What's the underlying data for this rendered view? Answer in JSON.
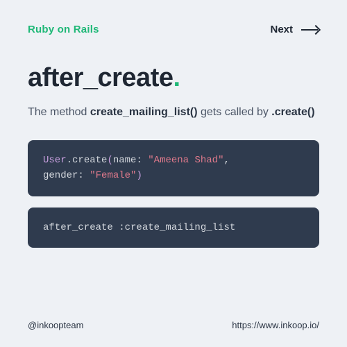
{
  "header": {
    "brand": "Ruby on Rails",
    "next_label": "Next"
  },
  "hero": {
    "title": "after_create",
    "dot": "."
  },
  "description": {
    "pre": "The method ",
    "method": "create_mailing_list()",
    "mid": " gets called by ",
    "caller": ".create()"
  },
  "code1": {
    "class": "User",
    "dot": ".",
    "method": "create",
    "lpar": "(",
    "arg1_key": "name",
    "colon1": ": ",
    "arg1_val": "\"Ameena Shad\"",
    "comma": ", ",
    "arg2_key": "gender",
    "colon2": ": ",
    "arg2_val": "\"Female\"",
    "rpar": ")"
  },
  "code2": {
    "callback": "after_create ",
    "symbol": ":create_mailing_list"
  },
  "footer": {
    "handle": "@inkoopteam",
    "url": "https://www.inkoop.io/"
  }
}
